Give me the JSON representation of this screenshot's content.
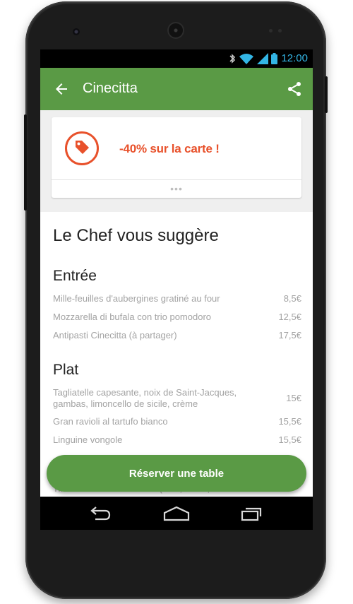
{
  "statusbar": {
    "time": "12:00",
    "icons": [
      "bluetooth-icon",
      "wifi-icon",
      "signal-icon",
      "battery-icon"
    ]
  },
  "appbar": {
    "title": "Cinecitta",
    "back_icon": "arrow-back-icon",
    "share_icon": "share-icon",
    "color": "#5a9a45"
  },
  "promo": {
    "icon": "price-tag-icon",
    "text": "-40% sur la carte !",
    "more": "•••",
    "accent": "#e8512b"
  },
  "menu": {
    "title": "Le Chef vous suggère",
    "sections": [
      {
        "title": "Entrée",
        "items": [
          {
            "name": "Mille-feuilles d'aubergines gratiné au four",
            "price": "8,5€"
          },
          {
            "name": "Mozzarella di bufala con trio pomodoro",
            "price": "12,5€"
          },
          {
            "name": "Antipasti Cinecitta (à partager)",
            "price": "17,5€"
          }
        ]
      },
      {
        "title": "Plat",
        "items": [
          {
            "name": "Tagliatelle capesante, noix de Saint-Jacques, gambas, limoncello de sicile, crème",
            "price": "15€"
          },
          {
            "name": "Gran ravioli al tartufo bianco",
            "price": "15,5€"
          },
          {
            "name": "Linguine vongole",
            "price": "15,5€"
          }
        ]
      }
    ],
    "partial_item": "Tiramisu maison au choix (café, fraise, framboise ou"
  },
  "reserve_button": {
    "label": "Réserver une table"
  },
  "navbar": {
    "icons": [
      "nav-back-icon",
      "nav-home-icon",
      "nav-recents-icon"
    ]
  }
}
